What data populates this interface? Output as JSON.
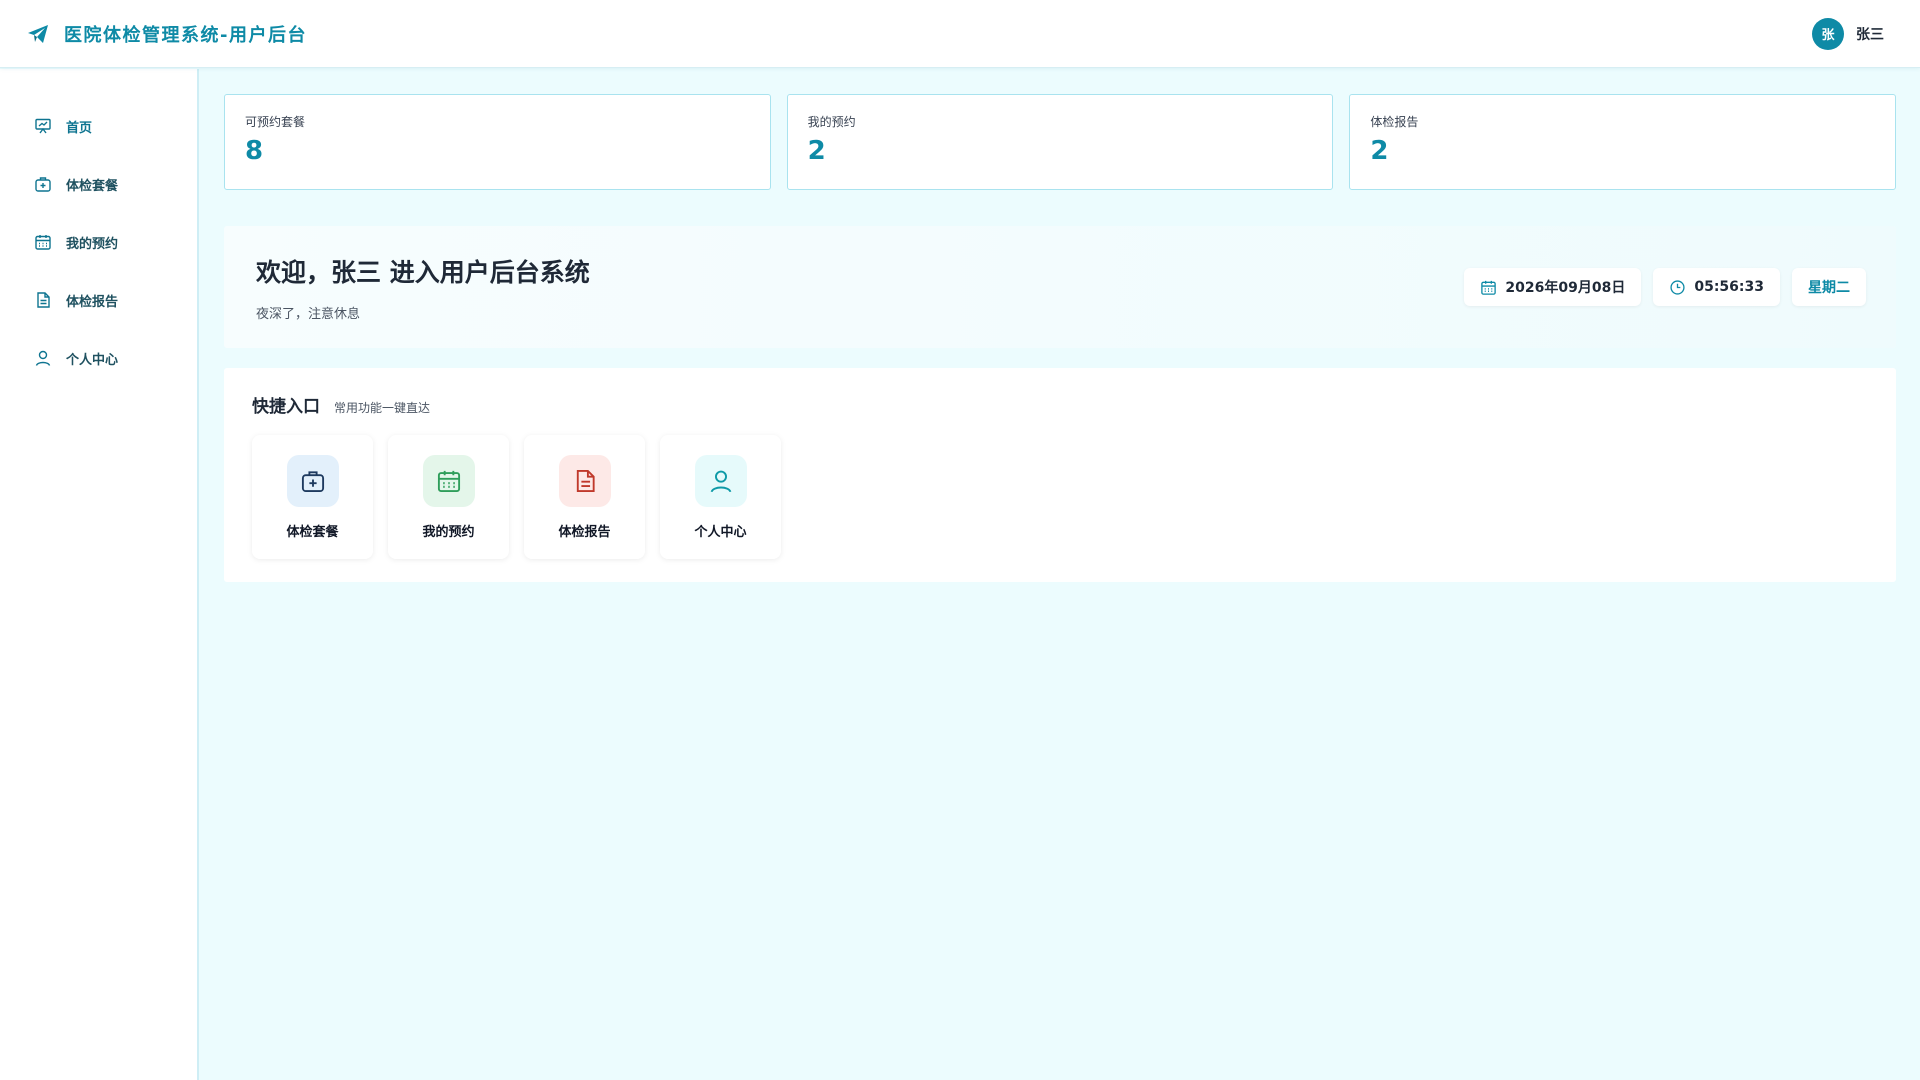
{
  "header": {
    "title": "医院体检管理系统-用户后台",
    "user": {
      "avatar_text": "张",
      "name": "张三"
    }
  },
  "sidebar": {
    "items": [
      {
        "label": "首页",
        "icon": "dashboard-icon",
        "active": true
      },
      {
        "label": "体检套餐",
        "icon": "medical-kit-icon"
      },
      {
        "label": "我的预约",
        "icon": "calendar-icon"
      },
      {
        "label": "体检报告",
        "icon": "document-icon"
      },
      {
        "label": "个人中心",
        "icon": "user-icon"
      }
    ]
  },
  "stats": [
    {
      "label": "可预约套餐",
      "value": "8"
    },
    {
      "label": "我的预约",
      "value": "2"
    },
    {
      "label": "体检报告",
      "value": "2"
    }
  ],
  "welcome": {
    "title": "欢迎，张三 进入用户后台系统",
    "subtitle": "夜深了，注意休息",
    "date": "2026年09月08日",
    "time": "05:56:33",
    "weekday": "星期二"
  },
  "quick": {
    "title": "快捷入口",
    "subtitle": "常用功能一键直达",
    "items": [
      {
        "label": "体检套餐",
        "icon": "medical-kit-icon",
        "bg": "#e3f0fb",
        "color": "#1e3a5f"
      },
      {
        "label": "我的预约",
        "icon": "calendar-icon",
        "bg": "#e4f6ea",
        "color": "#2f9e5b"
      },
      {
        "label": "体检报告",
        "icon": "document-icon",
        "bg": "#fde9e7",
        "color": "#c0392b"
      },
      {
        "label": "个人中心",
        "icon": "user-icon",
        "bg": "#e6fafb",
        "color": "#0e9aa7"
      }
    ]
  },
  "colors": {
    "accent": "#0e8aa6",
    "page_bg": "#ecfcfe"
  }
}
